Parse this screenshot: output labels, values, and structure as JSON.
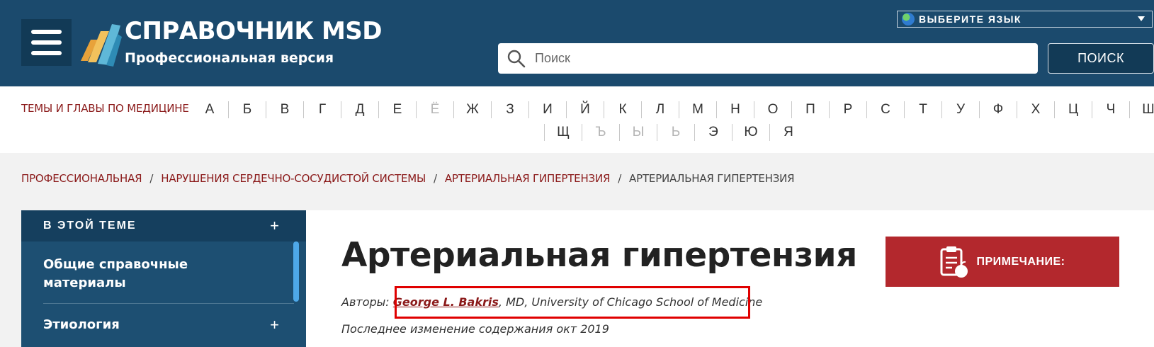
{
  "header": {
    "brand_title": "СПРАВОЧНИК MSD",
    "brand_subtitle": "Профессиональная версия",
    "language_select": "ВЫБЕРИТЕ ЯЗЫК",
    "search_placeholder": "Поиск",
    "search_button": "ПОИСК"
  },
  "alpha_nav": {
    "title": "ТЕМЫ И ГЛАВЫ ПО МЕДИЦИНЕ",
    "row1": [
      {
        "letter": "А",
        "enabled": true
      },
      {
        "letter": "Б",
        "enabled": true
      },
      {
        "letter": "В",
        "enabled": true
      },
      {
        "letter": "Г",
        "enabled": true
      },
      {
        "letter": "Д",
        "enabled": true
      },
      {
        "letter": "Е",
        "enabled": true
      },
      {
        "letter": "Ё",
        "enabled": false
      },
      {
        "letter": "Ж",
        "enabled": true
      },
      {
        "letter": "З",
        "enabled": true
      },
      {
        "letter": "И",
        "enabled": true
      },
      {
        "letter": "Й",
        "enabled": true
      },
      {
        "letter": "К",
        "enabled": true
      },
      {
        "letter": "Л",
        "enabled": true
      },
      {
        "letter": "М",
        "enabled": true
      },
      {
        "letter": "Н",
        "enabled": true
      },
      {
        "letter": "О",
        "enabled": true
      },
      {
        "letter": "П",
        "enabled": true
      },
      {
        "letter": "Р",
        "enabled": true
      },
      {
        "letter": "С",
        "enabled": true
      },
      {
        "letter": "Т",
        "enabled": true
      },
      {
        "letter": "У",
        "enabled": true
      },
      {
        "letter": "Ф",
        "enabled": true
      },
      {
        "letter": "Х",
        "enabled": true
      },
      {
        "letter": "Ц",
        "enabled": true
      },
      {
        "letter": "Ч",
        "enabled": true
      },
      {
        "letter": "Ш",
        "enabled": true
      }
    ],
    "row2": [
      {
        "letter": "Щ",
        "enabled": true
      },
      {
        "letter": "Ъ",
        "enabled": false
      },
      {
        "letter": "Ы",
        "enabled": false
      },
      {
        "letter": "Ь",
        "enabled": false
      },
      {
        "letter": "Э",
        "enabled": true
      },
      {
        "letter": "Ю",
        "enabled": true
      },
      {
        "letter": "Я",
        "enabled": true
      }
    ]
  },
  "breadcrumb": {
    "items": [
      "ПРОФЕССИОНАЛЬНАЯ",
      "НАРУШЕНИЯ СЕРДЕЧНО-СОСУДИСТОЙ СИСТЕМЫ",
      "АРТЕРИАЛЬНАЯ ГИПЕРТЕНЗИЯ"
    ],
    "current": "АРТЕРИАЛЬНАЯ ГИПЕРТЕНЗИЯ",
    "separator": "/"
  },
  "sidebar": {
    "header": "В ЭТОЙ ТЕМЕ",
    "expand_symbol": "+",
    "items": [
      {
        "label": "Общие справочные материалы"
      },
      {
        "label": "Этиология"
      }
    ]
  },
  "content": {
    "title": "Артериальная гипертензия",
    "authors_prefix": "Авторы:",
    "author_name": "George L. Bakris",
    "author_suffix": ", MD, University of Chicago School of Medicine",
    "updated": "Последнее изменение содержания окт 2019",
    "note_button": "ПРИМЕЧАНИЕ:"
  },
  "colors": {
    "header_bg": "#1b4a6d",
    "accent_red": "#8b1a1a",
    "note_red": "#b3282d",
    "highlight": "#e00000"
  }
}
